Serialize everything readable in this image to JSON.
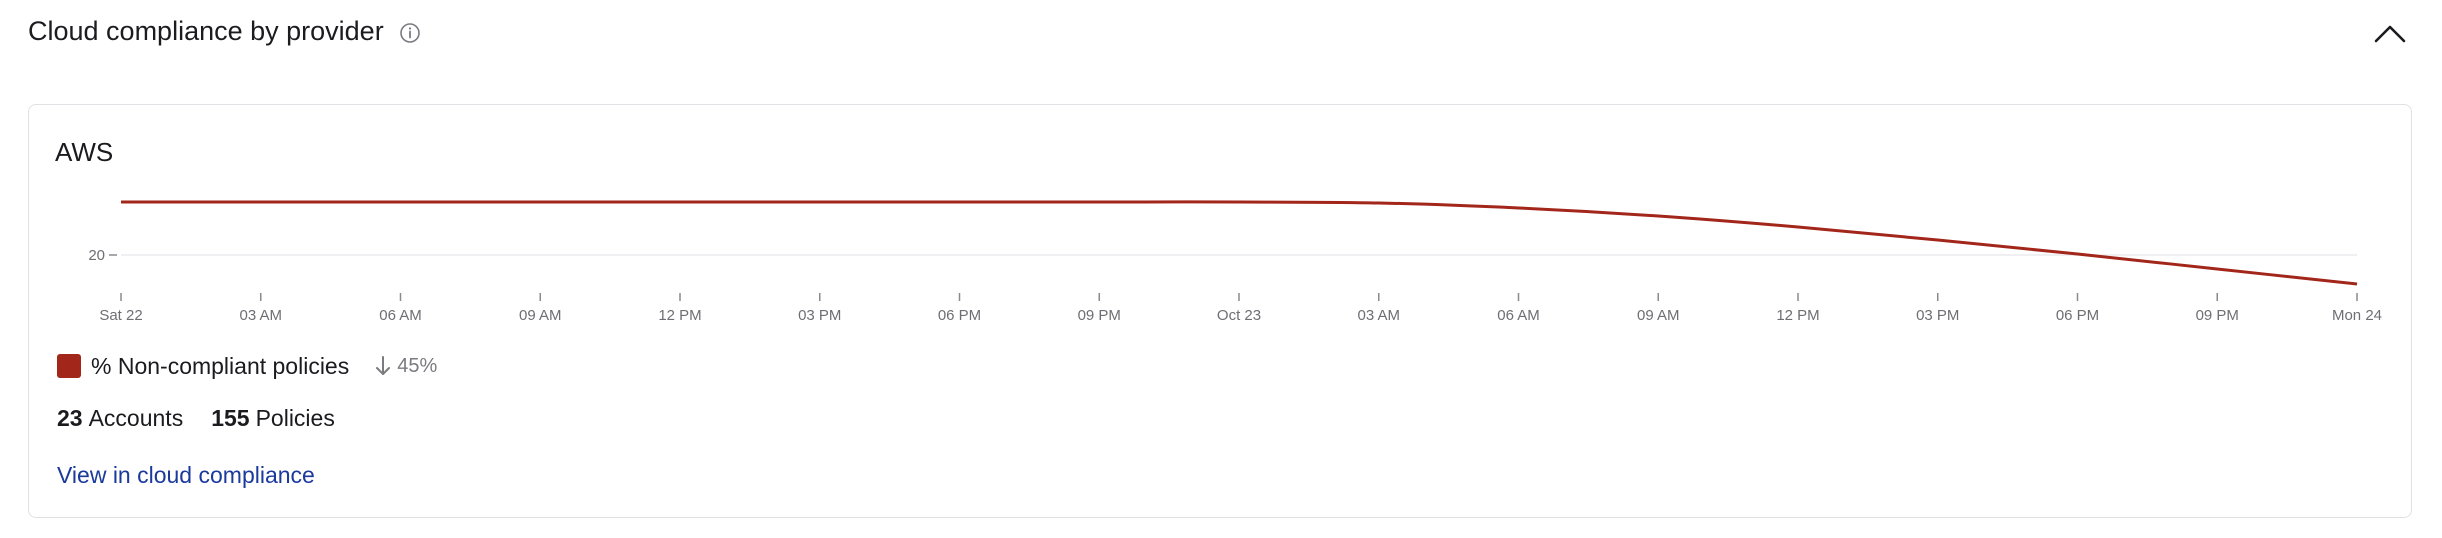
{
  "section": {
    "title": "Cloud compliance by provider",
    "info_icon": "info-icon",
    "collapse_icon": "chevron-up-icon"
  },
  "card": {
    "title": "AWS",
    "legend": {
      "label": "% Non-compliant policies",
      "color": "#a3261a",
      "change_icon": "arrow-down-icon",
      "change_value": "45%"
    },
    "stats": {
      "accounts_count": "23",
      "accounts_label": "Accounts",
      "policies_count": "155",
      "policies_label": "Policies"
    },
    "link": "View in cloud compliance"
  },
  "chart_data": {
    "type": "line",
    "x_ticks": [
      "Sat 22",
      "03 AM",
      "06 AM",
      "09 AM",
      "12 PM",
      "03 PM",
      "06 PM",
      "09 PM",
      "Oct 23",
      "03 AM",
      "06 AM",
      "09 AM",
      "12 PM",
      "03 PM",
      "06 PM",
      "09 PM",
      "Mon 24"
    ],
    "y_ticks": [
      20
    ],
    "series": [
      {
        "color": "#a3261a",
        "x_hours": [
          0,
          3,
          6,
          9,
          12,
          15,
          18,
          21,
          24,
          27,
          30,
          33,
          36,
          39,
          42,
          45,
          48
        ],
        "values": [
          25.3,
          25.3,
          25.3,
          25.3,
          25.3,
          25.3,
          25.3,
          25.3,
          25.3,
          25.2,
          24.7,
          23.9,
          22.8,
          21.5,
          20.1,
          18.6,
          17.1
        ]
      }
    ],
    "grid": "horizontal",
    "legend": "bottom-left"
  }
}
